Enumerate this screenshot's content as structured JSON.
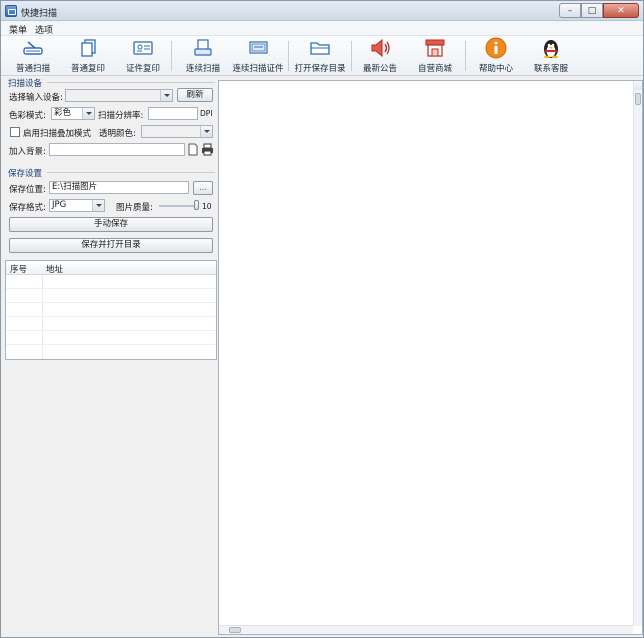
{
  "window": {
    "title": "快捷扫描",
    "minimize": "–",
    "maximize": "□",
    "close": "✕"
  },
  "menu": [
    "菜单",
    "选项"
  ],
  "toolbar": [
    {
      "label": "普通扫描",
      "icon": "scanner-icon"
    },
    {
      "label": "普通复印",
      "icon": "copy-icon"
    },
    {
      "label": "证件复印",
      "icon": "id-card-icon"
    },
    {
      "label": "连续扫描",
      "icon": "continuous-scan-icon"
    },
    {
      "label": "连续扫描证件",
      "icon": "continuous-id-scan-icon"
    },
    {
      "label": "打开保存目录",
      "icon": "folder-icon"
    },
    {
      "label": "最新公告",
      "icon": "speaker-icon"
    },
    {
      "label": "自营商城",
      "icon": "store-icon"
    },
    {
      "label": "帮助中心",
      "icon": "info-icon"
    },
    {
      "label": "联系客服",
      "icon": "penguin-icon"
    }
  ],
  "scan_settings": {
    "group_title": "扫描设备",
    "device_label": "选择输入设备:",
    "device_value": "",
    "refresh_label": "刷新",
    "color_mode_label": "色彩模式:",
    "color_mode_value": "彩色",
    "resolution_label": "扫描分辨率:",
    "resolution_value": "",
    "resolution_unit": "DPI",
    "overlay_label": "启用扫描叠加模式",
    "transparent_label": "透明颜色:",
    "transparent_value": "",
    "background_label": "加入背景:",
    "background_value": ""
  },
  "save_settings": {
    "group_title": "保存设置",
    "location_label": "保存位置:",
    "location_value": "E:\\扫描图片",
    "browse_label": "...",
    "format_label": "保存格式:",
    "format_value": "JPG",
    "quality_label": "图片质量:",
    "quality_value": "10",
    "quality_level": 1.0,
    "manual_save_label": "手动保存",
    "save_open_label": "保存并打开目录"
  },
  "table": {
    "columns": [
      "序号",
      "地址"
    ],
    "rows": []
  },
  "colors": {
    "accent": "#2f6db3",
    "title_bar": "#d8e2ee",
    "info_orange": "#f08a1c",
    "speaker_red": "#d13b2e"
  }
}
